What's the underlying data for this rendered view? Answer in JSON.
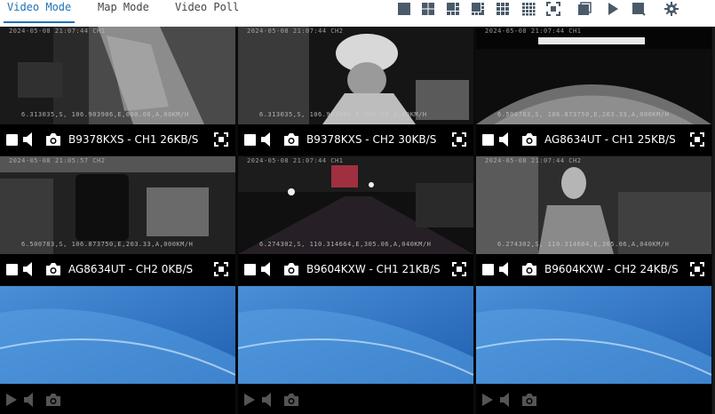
{
  "tabs": [
    {
      "label": "Video Mode",
      "active": true
    },
    {
      "label": "Map Mode",
      "active": false
    },
    {
      "label": "Video Poll",
      "active": false
    }
  ],
  "toolbar": {
    "icons": [
      "layout-1-icon",
      "layout-4-icon",
      "layout-6-icon",
      "layout-8-icon",
      "layout-9-icon",
      "layout-16-icon",
      "fullscreen-toggle-icon",
      "window-icon",
      "play-icon",
      "stop-icon",
      "settings-icon"
    ],
    "icon_color": "#4a5a6a"
  },
  "cells": [
    {
      "title": "B9378KXS - CH1 26KB/S",
      "timestamp": "2024-05-08 21:07:44 CH1",
      "gps": "6.313035,S,  106.903906,E,000.00,A,00KM/H",
      "checked": false
    },
    {
      "title": "B9378KXS - CH2 30KB/S",
      "timestamp": "2024-05-08 21:07:44 CH2",
      "gps": "6.313035,S,  106.903906,E,000.00,A,00KM/H",
      "checked": false
    },
    {
      "title": "AG8634UT - CH1 25KB/S",
      "timestamp": "2024-05-08 21:07:44 CH1",
      "gps": "6.500783,S,  106.873750,E,203.33,A,000KM/H",
      "checked": false
    },
    {
      "title": "AG8634UT - CH2 0KB/S",
      "timestamp": "2024-05-08 21:05:57 CH2",
      "gps": "6.500783,S,  106.873750,E,203.33,A,000KM/H",
      "checked": false
    },
    {
      "title": "B9604KXW - CH1 21KB/S",
      "timestamp": "2024-05-08 21:07:44 CH1",
      "gps": "6.274302,S,  110.314664,E,305.06,A,040KM/H",
      "checked": false
    },
    {
      "title": "B9604KXW - CH2 24KB/S",
      "timestamp": "2024-05-08 21:07:44 CH2",
      "gps": "6.274302,S,  110.314664,E,305.06,A,040KM/H",
      "checked": false
    }
  ],
  "colors": {
    "accent": "#1d72b8",
    "selected_border": "#2f7a3a",
    "bar_bg": "#000000",
    "empty_bg": "#2a6fc4"
  }
}
